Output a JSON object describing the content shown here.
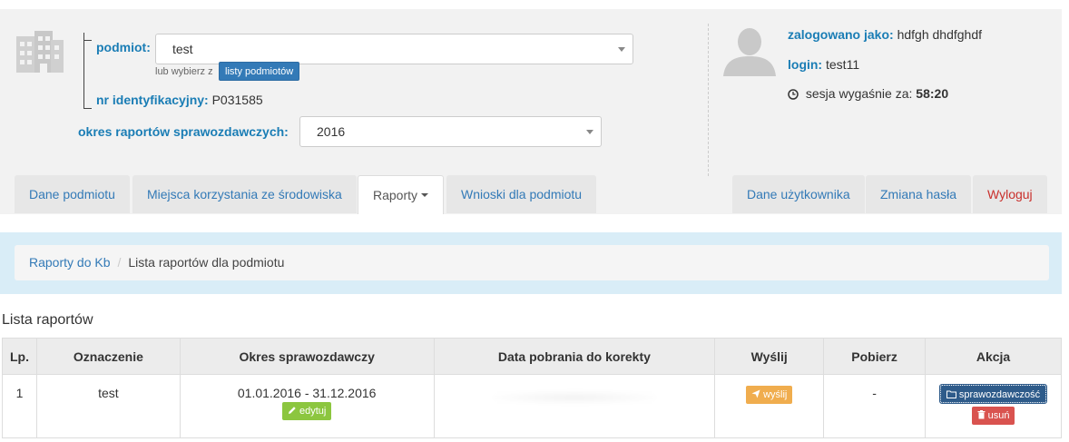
{
  "header": {
    "podmiot_label": "podmiot:",
    "podmiot_value": "test",
    "lub_wybierz": "lub wybierz z",
    "lista_button": "listy podmiotów",
    "nr_label": "nr identyfikacyjny:",
    "nr_value": "P031585",
    "okres_label": "okres raportów sprawozdawczych:",
    "okres_value": "2016"
  },
  "user": {
    "logged_label": "zalogowano jako:",
    "logged_value": "hdfgh dhdfghdf",
    "login_label": "login:",
    "login_value": "test11",
    "session_label": "sesja wygaśnie za:",
    "session_value": "58:20"
  },
  "tabs_left": [
    {
      "label": "Dane podmiotu"
    },
    {
      "label": "Miejsca korzystania ze środowiska"
    },
    {
      "label": "Raporty"
    },
    {
      "label": "Wnioski dla podmiotu"
    }
  ],
  "tabs_right": [
    {
      "label": "Dane użytkownika"
    },
    {
      "label": "Zmiana hasła"
    },
    {
      "label": "Wyloguj"
    }
  ],
  "breadcrumb": {
    "link": "Raporty do Kb",
    "separator": "/",
    "current": "Lista raportów dla podmiotu"
  },
  "list_title": "Lista raportów",
  "table": {
    "headers": [
      "Lp.",
      "Oznaczenie",
      "Okres sprawozdawczy",
      "Data pobrania do korekty",
      "Wyślij",
      "Pobierz",
      "Akcja"
    ],
    "rows": [
      {
        "lp": "1",
        "oznaczenie": "test",
        "okres": "01.01.2016 - 31.12.2016",
        "edit_label": "edytuj",
        "send_label": "wyślij",
        "pobierz": "-",
        "spr_label": "sprawozdawczość",
        "del_label": "usuń"
      }
    ]
  },
  "colors": {
    "label_blue": "#1a7db5",
    "link_blue": "#337ab7",
    "edit_green": "#8cc63f",
    "send_orange": "#f0ad4e",
    "delete_red": "#d9534f",
    "breadcrumb_bg": "#d9edf7"
  }
}
